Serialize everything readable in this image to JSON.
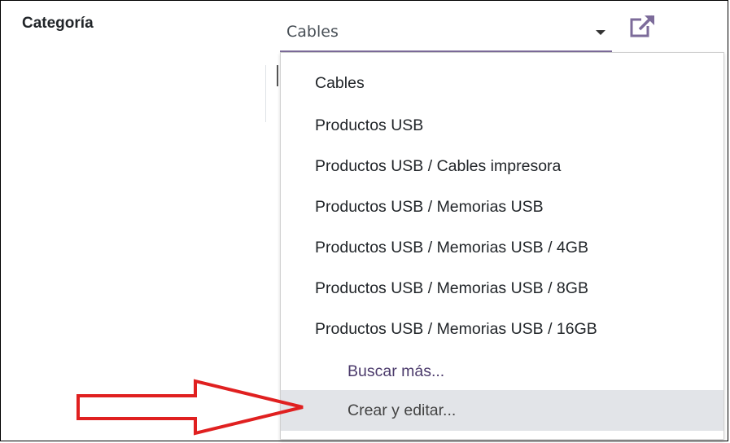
{
  "field": {
    "label": "Categoría",
    "value": "Cables",
    "link_icon": "external-link-icon",
    "accent_color": "#7c6b9a"
  },
  "dropdown": {
    "items": [
      "Cables",
      "Productos USB",
      "Productos USB / Cables impresora",
      "Productos USB / Memorias USB",
      "Productos USB / Memorias USB / 4GB",
      "Productos USB / Memorias USB / 8GB",
      "Productos USB / Memorias USB / 16GB"
    ],
    "search_more": "Buscar más...",
    "create_edit": "Crear y editar..."
  },
  "annotation": {
    "arrow_color": "#e02020"
  }
}
